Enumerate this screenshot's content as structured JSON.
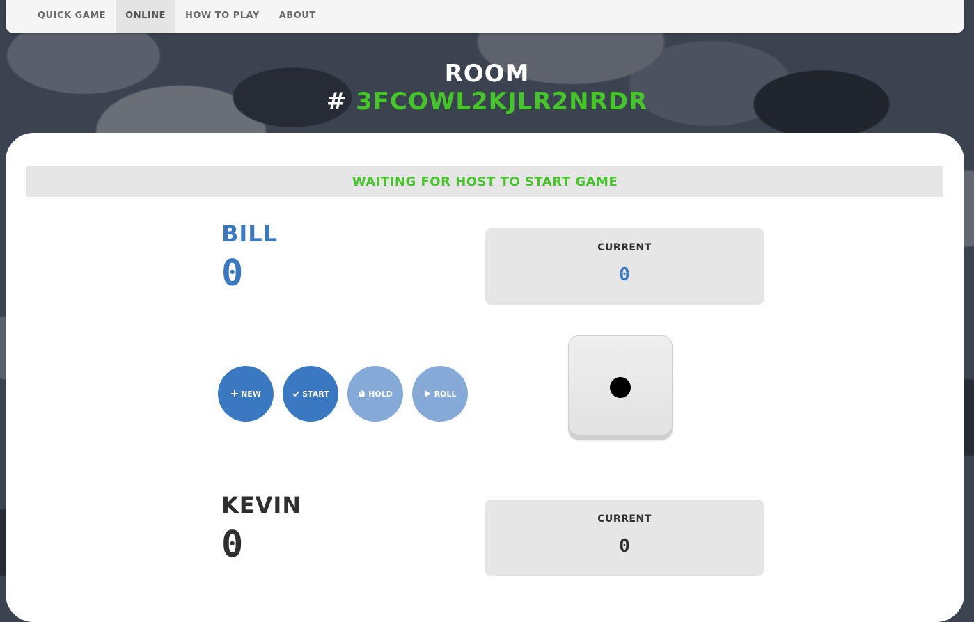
{
  "nav": {
    "items": [
      {
        "label": "QUICK GAME",
        "active": false
      },
      {
        "label": "ONLINE",
        "active": true
      },
      {
        "label": "HOW TO PLAY",
        "active": false
      },
      {
        "label": "ABOUT",
        "active": false
      }
    ]
  },
  "room": {
    "title": "ROOM",
    "hash": "#",
    "code": "3FCOWL2KJLR2NRDR"
  },
  "status": "WAITING FOR HOST TO START GAME",
  "players": [
    {
      "name": "BILL",
      "score": "0",
      "current_label": "CURRENT",
      "current": "0",
      "color": "#3a78c2"
    },
    {
      "name": "KEVIN",
      "score": "0",
      "current_label": "CURRENT",
      "current": "0",
      "color": "#2f2f2f"
    }
  ],
  "buttons": {
    "new": {
      "label": "NEW",
      "icon": "plus-icon",
      "enabled": true
    },
    "start": {
      "label": "START",
      "icon": "check-icon",
      "enabled": true
    },
    "hold": {
      "label": "HOLD",
      "icon": "hand-icon",
      "enabled": false
    },
    "roll": {
      "label": "ROLL",
      "icon": "play-icon",
      "enabled": false
    }
  },
  "die": {
    "value": 1
  },
  "colors": {
    "accent_blue": "#3a78c2",
    "accent_green": "#46c52a",
    "disabled_blue": "#85aad8"
  }
}
